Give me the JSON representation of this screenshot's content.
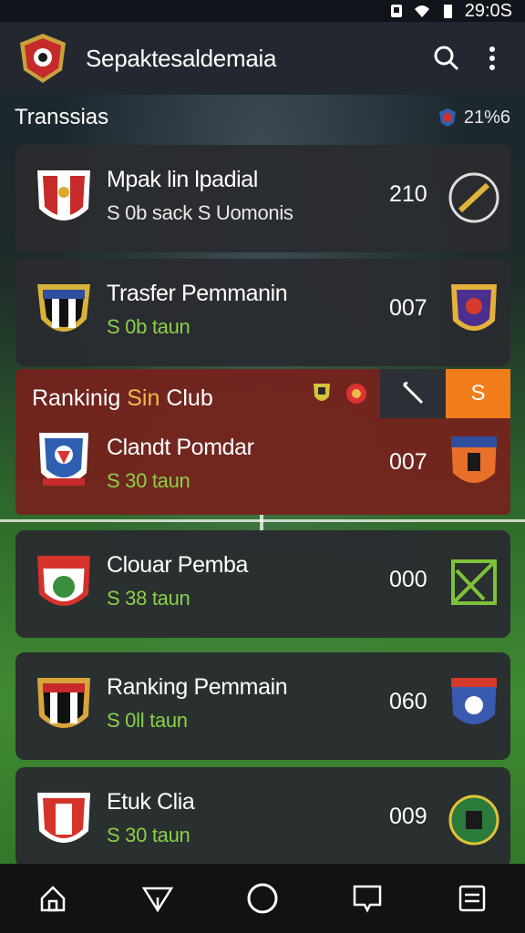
{
  "status_bar": {
    "time": "29:0S"
  },
  "app_bar": {
    "title": "Sepaktesaldemaia"
  },
  "section": {
    "title": "Transsias",
    "meta": "21%6"
  },
  "cards": [
    {
      "name": "Mpak lin lpadial",
      "sub": "S 0b sack S Uomonis",
      "score": "210"
    },
    {
      "name": "Trasfer Pemmanin",
      "sub": "S 0b taun",
      "score": "007"
    },
    {
      "name": "Clandt Pomdar",
      "sub": "S 30 taun",
      "score": "007"
    },
    {
      "name": "Clouar Pemba",
      "sub": "S 38 taun",
      "score": "000"
    },
    {
      "name": "Ranking Pemmain",
      "sub": "S 0ll taun",
      "score": "060"
    },
    {
      "name": "Etuk Clia",
      "sub": "S 30 taun",
      "score": "009"
    }
  ],
  "highlight": {
    "lead": "Rankinig",
    "accent": "Sin",
    "club": "Club",
    "action": "S"
  },
  "bottom_nav": [
    "home",
    "send",
    "circle",
    "message",
    "list"
  ]
}
